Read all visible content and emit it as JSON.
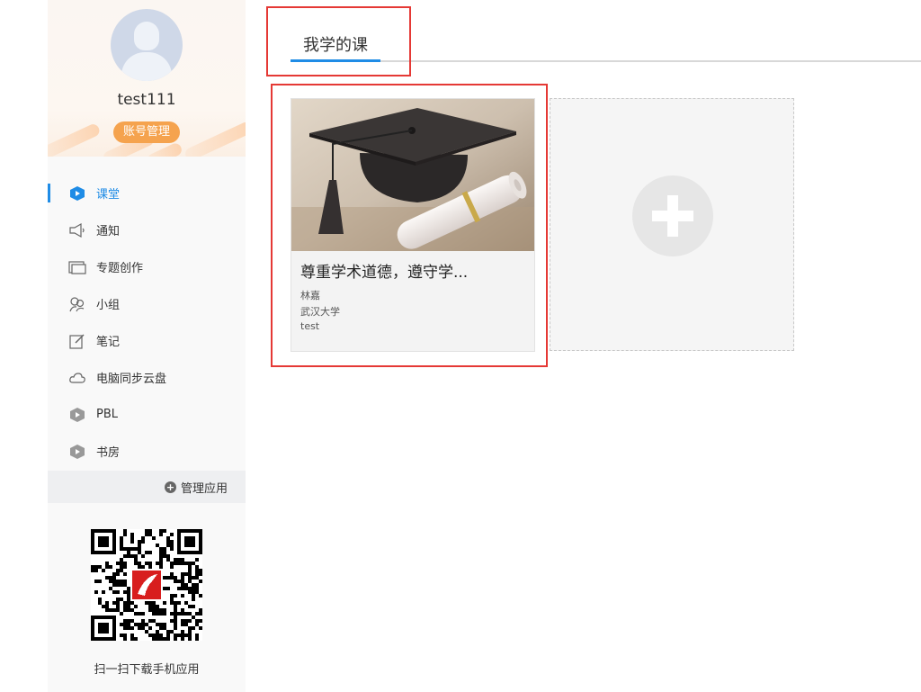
{
  "profile": {
    "username": "test111",
    "account_button": "账号管理"
  },
  "menu": [
    {
      "label": "课堂",
      "icon": "classroom-icon",
      "active": true
    },
    {
      "label": "通知",
      "icon": "speaker-icon"
    },
    {
      "label": "专题创作",
      "icon": "window-icon"
    },
    {
      "label": "小组",
      "icon": "group-icon"
    },
    {
      "label": "笔记",
      "icon": "note-edit-icon"
    },
    {
      "label": "电脑同步云盘",
      "icon": "cloud-icon"
    },
    {
      "label": "PBL",
      "icon": "pbl-icon"
    },
    {
      "label": "书房",
      "icon": "study-room-icon"
    }
  ],
  "manage_apps": "管理应用",
  "qr_caption": "扫一扫下载手机应用",
  "main": {
    "tab": "我学的课"
  },
  "course": {
    "title": "尊重学术道德，遵守学...",
    "teacher": "林嘉",
    "school": "武汉大学",
    "class": "test"
  },
  "colors": {
    "accent": "#1f8ce6",
    "account_button": "#f5a34e",
    "highlight": "#e53935"
  }
}
